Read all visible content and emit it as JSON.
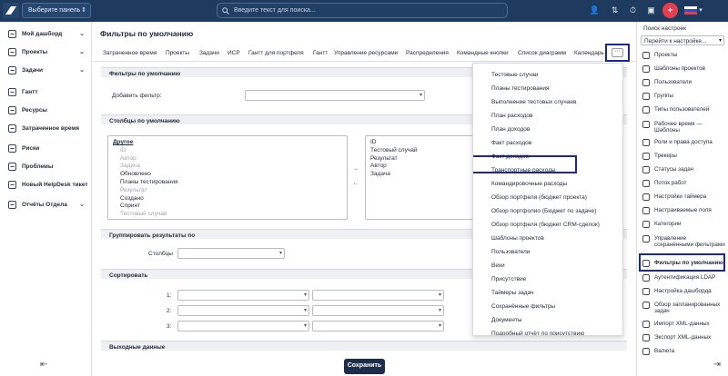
{
  "topbar": {
    "panel_select": "Выберите панель",
    "search_placeholder": "Введите текст для поиска..."
  },
  "sidebar": {
    "items": [
      {
        "label": "Мой дашборд",
        "expandable": true
      },
      {
        "label": "Проекты",
        "expandable": true
      },
      {
        "label": "Задачи",
        "expandable": true
      },
      {
        "label": "Гантт",
        "expandable": false
      },
      {
        "label": "Ресурсы",
        "expandable": false
      },
      {
        "label": "Затраченное время",
        "expandable": false
      },
      {
        "label": "Риски",
        "expandable": false
      },
      {
        "label": "Проблемы",
        "expandable": false
      },
      {
        "label": "Новый HelpDesk тикет",
        "expandable": false
      },
      {
        "label": "Отчёты Отдела",
        "expandable": true
      }
    ]
  },
  "main": {
    "title": "Фильтры по умолчанию",
    "tabs": [
      "Затраченное время",
      "Проекты",
      "Задачи",
      "ИСР",
      "Гантт для портфеля",
      "Гантт",
      "Управление ресурсами",
      "Распределения",
      "Командные кнопки",
      "Список диаграмм",
      "Календарь"
    ],
    "more_label": "···",
    "sections": {
      "default_filters": "Фильтры по умолчанию",
      "default_columns": "Столбцы по умолчанию",
      "group_by": "Группировать результаты по",
      "sort": "Сортировать",
      "output": "Выходные данные"
    },
    "add_filter_label": "Добавить фильтр:",
    "available_columns": [
      {
        "text": "Другое",
        "style": "bold"
      },
      {
        "text": "ID",
        "style": "dim"
      },
      {
        "text": "Автор",
        "style": "dim"
      },
      {
        "text": "Задача",
        "style": "dim"
      },
      {
        "text": "Обновлено",
        "style": "normal"
      },
      {
        "text": "Планы тестирования",
        "style": "normal"
      },
      {
        "text": "Результат",
        "style": "dim"
      },
      {
        "text": "Создано",
        "style": "normal"
      },
      {
        "text": "Спринт",
        "style": "normal"
      },
      {
        "text": "Тестовый случай",
        "style": "dim"
      }
    ],
    "selected_columns": [
      "ID",
      "Тестовый случай",
      "Результат",
      "Автор",
      "Задача"
    ],
    "columns_label": "Столбцы",
    "sort_rows": [
      "1:",
      "2:",
      "3:"
    ],
    "save_button": "Сохранить"
  },
  "dropdown": {
    "items": [
      "Тестовые случаи",
      "Планы тестирования",
      "Выполнение тестовых случаев",
      "План расходов",
      "План доходов",
      "Факт расходов",
      "Факт доходов",
      "Транспортные расходы",
      "Командировочные расходы",
      "Обзор портфеля (бюджет проекта)",
      "Обзор портфолио (Бюджет по задаче)",
      "Обзор портфеля (бюджет CRM-сделок)",
      "Шаблоны проектов",
      "Пользователи",
      "Вехи",
      "Присутствие",
      "Таймеры задач",
      "Сохранённые фильтры",
      "Документы",
      "Подробный отчёт по присутствию"
    ],
    "highlighted_index": 2
  },
  "right_panel": {
    "header": "Поиск настроек",
    "select": "Перейти к настройке...",
    "items": [
      "Проекты",
      "Шаблоны проектов",
      "Пользователи",
      "Группы",
      "Типы пользователей",
      "Рабочее время — Шаблоны",
      "Роли и права доступа",
      "Трекеры",
      "Статусы задач",
      "Поток работ",
      "Настройки таймера",
      "Настраиваемые поля",
      "Категории",
      "Управление сохранёнными фильтрами",
      "Фильтры по умолчанию",
      "Аутентификация LDAP",
      "Настройка дашборда",
      "Обзор запланированных задач",
      "Импорт XML-данных",
      "Экспорт XML-данных",
      "Валюта"
    ],
    "active_index": 14
  },
  "colors": {
    "topbar": "#1e3a5f",
    "accent": "#e63e4f",
    "highlight": "#1a2a8c",
    "save_button": "#1f2d4d"
  }
}
